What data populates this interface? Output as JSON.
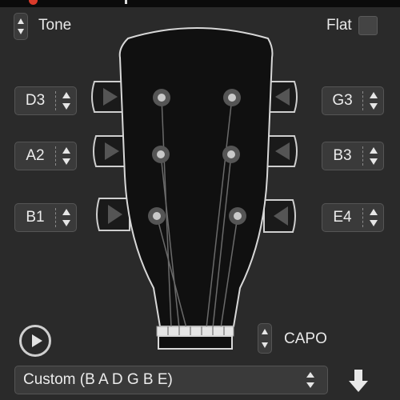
{
  "header": {
    "tone_label": "Tone",
    "flat_label": "Flat",
    "flat_checked": false
  },
  "tuning": {
    "left": [
      {
        "note": "D3"
      },
      {
        "note": "A2"
      },
      {
        "note": "B1"
      }
    ],
    "right": [
      {
        "note": "G3"
      },
      {
        "note": "B3"
      },
      {
        "note": "E4"
      }
    ]
  },
  "capo": {
    "label": "CAPO"
  },
  "preset": {
    "selected": "Custom (B A D G B E)"
  },
  "icons": {
    "play": "play-icon",
    "download": "download-arrow-icon",
    "flat_checkbox": "checkbox-icon"
  }
}
